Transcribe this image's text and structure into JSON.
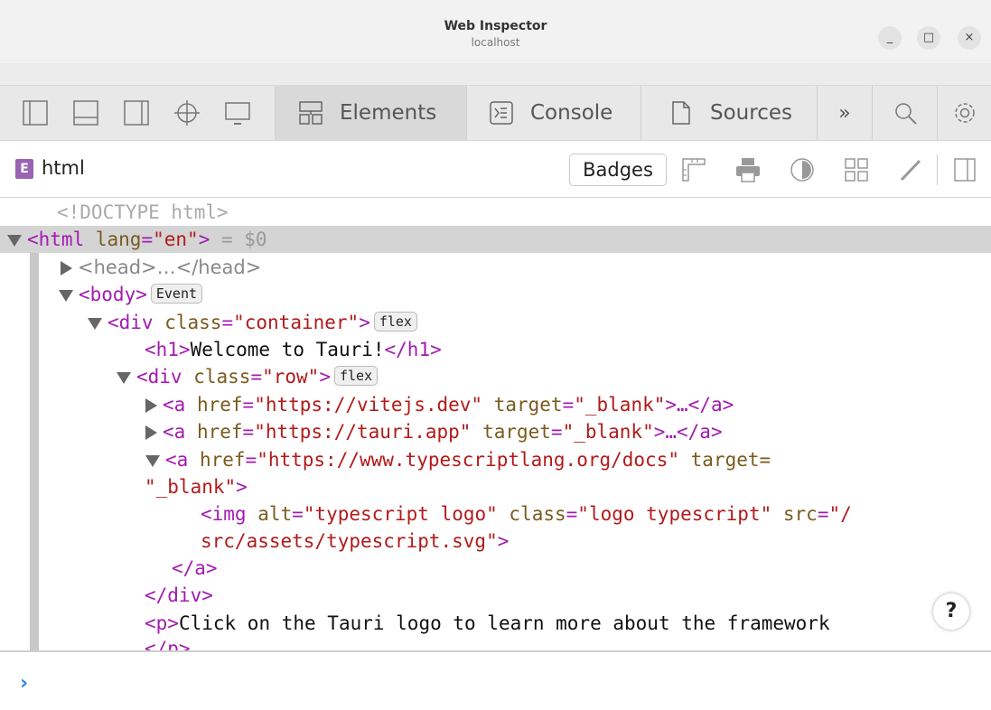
{
  "window": {
    "title": "Web Inspector",
    "subtitle": "localhost",
    "minimize": "_",
    "maximize": "□",
    "close": "×"
  },
  "toolbar": {
    "tabs": [
      {
        "label": "Elements",
        "selected": true
      },
      {
        "label": "Console",
        "selected": false
      },
      {
        "label": "Sources",
        "selected": false
      }
    ],
    "more": "»"
  },
  "breadcrumb": {
    "badge": "E",
    "label": "html",
    "badges_button": "Badges"
  },
  "tree": {
    "doctype": "<!DOCTYPE html>",
    "html_open": "<html",
    "html_attr_name": "lang",
    "html_attr_value": "\"en\"",
    "html_close": ">",
    "selected_marker": "= $0",
    "head": "<head>…</head>",
    "body_open": "<body>",
    "body_chip": "Event",
    "div_container": {
      "tag": "<div",
      "attr": "class",
      "value": "\"container\"",
      "end": ">",
      "chip": "flex"
    },
    "h1_open": "<h1>",
    "h1_text": "Welcome to Tauri!",
    "h1_close": "</h1>",
    "div_row": {
      "tag": "<div",
      "attr": "class",
      "value": "\"row\"",
      "end": ">",
      "chip": "flex"
    },
    "a1": {
      "tag": "<a",
      "href_name": "href",
      "href": "\"https://vitejs.dev\"",
      "target_name": "target",
      "target": "\"_blank\"",
      "end": ">…</a>"
    },
    "a2": {
      "tag": "<a",
      "href_name": "href",
      "href": "\"https://tauri.app\"",
      "target_name": "target",
      "target": "\"_blank\"",
      "end": ">…</a>"
    },
    "a3": {
      "tag": "<a",
      "href_name": "href",
      "href": "\"https://www.typescriptlang.org/docs\"",
      "target_name": "target=",
      "target": "\"_blank\"",
      "end": ">"
    },
    "img": {
      "tag": "<img",
      "alt_name": "alt",
      "alt": "\"typescript logo\"",
      "class_name": "class",
      "class": "\"logo typescript\"",
      "src_name": "src",
      "src_a": "\"/",
      "src_b": "src/assets/typescript.svg\"",
      "end": ">"
    },
    "a3_close": "</a>",
    "div_close": "</div>",
    "p_open": "<p>",
    "p_text": "Click on the Tauri logo to learn more about the framework",
    "p_close": "</p>"
  },
  "help": "?",
  "console": {
    "prompt": "›"
  }
}
